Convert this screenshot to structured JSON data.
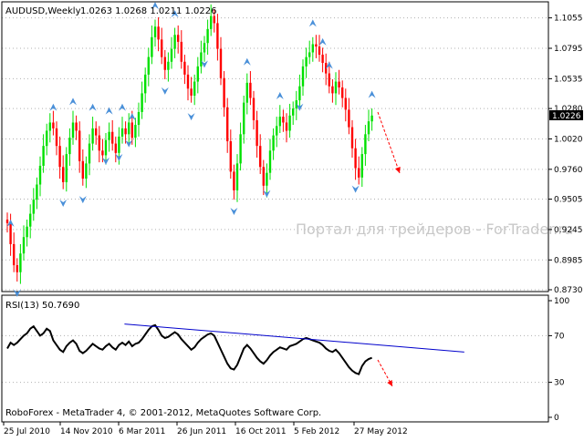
{
  "header": {
    "symbol": "AUDUSD,Weekly",
    "ohlc": "1.0263 1.0268 1.0211 1.0226"
  },
  "watermark": "Портал для трейдеров - ForTrader.ru",
  "rsi_header": "RSI(13) 50.7690",
  "footer": "RoboForex - MetaTrader 4, © 2001-2012, MetaQuotes Software Corp.",
  "current_price": "1.0226",
  "colors": {
    "bull": "#00e000",
    "bear": "#ff0000",
    "fractal": "#4a90d9",
    "rsi_line": "#000000",
    "trendline": "#0000cc",
    "forecast_arrow": "#ff0000",
    "grid": "#b0b0b0"
  },
  "chart_data": [
    {
      "type": "candlestick",
      "title": "AUDUSD,Weekly",
      "y_ticks": [
        "1.1055",
        "1.0795",
        "1.0535",
        "1.0280",
        "1.0020",
        "0.9760",
        "0.9505",
        "0.9245",
        "0.8985",
        "0.8730"
      ],
      "ylim": [
        0.873,
        1.113
      ],
      "x_ticks": [
        "25 Jul 2010",
        "14 Nov 2010",
        "6 Mar 2011",
        "26 Jun 2011",
        "16 Oct 2011",
        "5 Feb 2012",
        "27 May 2012"
      ],
      "last_price": 1.0226,
      "closes": [
        0.93,
        0.912,
        0.894,
        0.888,
        0.904,
        0.918,
        0.927,
        0.938,
        0.95,
        0.963,
        0.979,
        0.996,
        1.009,
        1.016,
        1.011,
        0.996,
        0.978,
        0.965,
        0.989,
        1.003,
        1.016,
        1.009,
        0.983,
        0.968,
        0.981,
        0.998,
        1.011,
        1.005,
        0.992,
        0.988,
        1.001,
        1.008,
        0.998,
        0.99,
        1.004,
        1.011,
        1.006,
        1.016,
        1.003,
        1.014,
        1.025,
        1.041,
        1.057,
        1.072,
        1.089,
        1.098,
        1.087,
        1.072,
        1.061,
        1.068,
        1.079,
        1.091,
        1.085,
        1.068,
        1.057,
        1.045,
        1.039,
        1.051,
        1.064,
        1.076,
        1.084,
        1.096,
        1.107,
        1.101,
        1.079,
        1.054,
        1.029,
        1.0,
        0.974,
        0.958,
        0.981,
        1.006,
        1.033,
        1.05,
        1.037,
        1.018,
        0.996,
        0.978,
        0.962,
        0.973,
        0.992,
        1.005,
        1.013,
        1.021,
        1.016,
        1.009,
        1.022,
        1.028,
        1.035,
        1.047,
        1.064,
        1.072,
        1.076,
        1.083,
        1.081,
        1.074,
        1.067,
        1.058,
        1.047,
        1.041,
        1.051,
        1.046,
        1.037,
        1.027,
        1.012,
        0.994,
        0.977,
        0.969,
        0.989,
        1.006,
        1.017,
        1.022
      ],
      "fractals_up_idx": [
        1,
        14,
        20,
        26,
        31,
        35,
        38,
        45,
        51,
        62,
        73,
        83,
        93,
        96,
        98,
        111
      ],
      "fractals_down_idx": [
        3,
        17,
        23,
        30,
        34,
        37,
        48,
        56,
        60,
        69,
        79,
        89,
        106
      ]
    },
    {
      "type": "line",
      "title": "RSI(13) 50.7690",
      "y_ticks": [
        "100",
        "70",
        "30",
        "0"
      ],
      "ylim": [
        0,
        100
      ],
      "levels": [
        70,
        30
      ],
      "last_value": 50.769,
      "values": [
        59,
        64,
        62,
        64,
        67,
        70,
        72,
        76,
        78,
        74,
        70,
        72,
        76,
        74,
        66,
        62,
        58,
        56,
        61,
        64,
        66,
        63,
        57,
        55,
        57,
        60,
        63,
        61,
        59,
        58,
        61,
        63,
        60,
        58,
        62,
        64,
        62,
        65,
        61,
        63,
        64,
        67,
        71,
        75,
        78,
        79,
        75,
        70,
        68,
        69,
        71,
        73,
        71,
        67,
        64,
        61,
        58,
        60,
        64,
        67,
        69,
        71,
        72,
        70,
        64,
        58,
        52,
        46,
        42,
        41,
        45,
        52,
        59,
        62,
        59,
        55,
        51,
        48,
        46,
        49,
        53,
        56,
        58,
        60,
        59,
        58,
        61,
        62,
        63,
        65,
        67,
        68,
        67,
        66,
        65,
        64,
        62,
        59,
        57,
        56,
        58,
        55,
        51,
        47,
        43,
        40,
        38,
        37,
        44,
        48,
        50,
        51
      ],
      "trendline": {
        "from": [
          19,
          80
        ],
        "to": [
          128,
          56
        ]
      }
    }
  ]
}
